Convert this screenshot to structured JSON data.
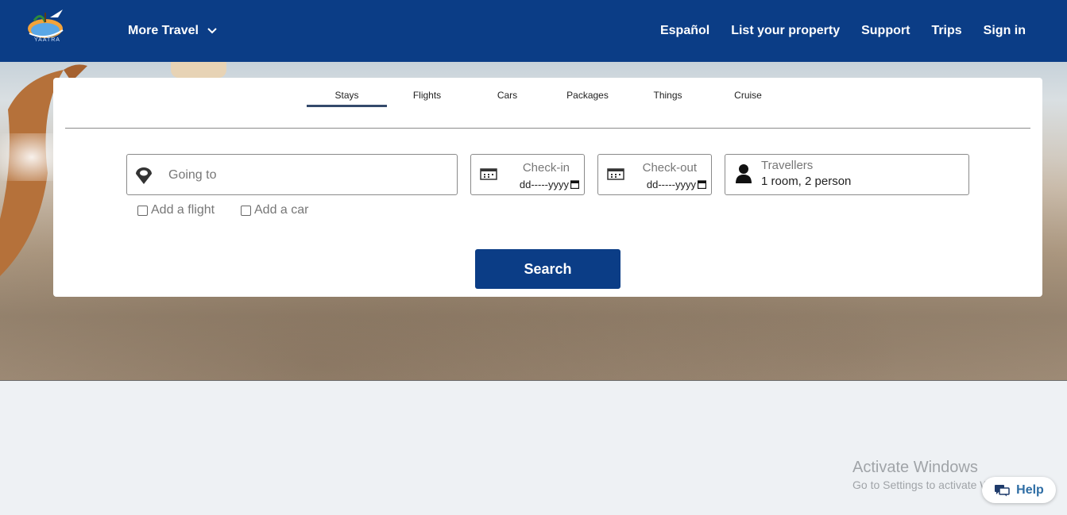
{
  "header": {
    "logo_text": "YAATRA",
    "more_travel": "More Travel",
    "nav": [
      "Español",
      "List your property",
      "Support",
      "Trips",
      "Sign in"
    ]
  },
  "tabs": [
    {
      "label": "Stays",
      "active": true
    },
    {
      "label": "Flights"
    },
    {
      "label": "Cars"
    },
    {
      "label": "Packages"
    },
    {
      "label": "Things"
    },
    {
      "label": "Cruise"
    }
  ],
  "search": {
    "going_placeholder": "Going to",
    "checkin_label": "Check-in",
    "checkin_value": "dd-----yyyy",
    "checkout_label": "Check-out",
    "checkout_value": "dd-----yyyy",
    "travellers_label": "Travellers",
    "travellers_value": "1 room, 2 person",
    "add_flight": "Add a flight",
    "add_car": "Add a car",
    "button": "Search"
  },
  "watermark": {
    "title": "Activate Windows",
    "subtitle": "Go to Settings to activate Windows."
  },
  "help": {
    "label": "Help"
  },
  "colors": {
    "primary": "#0b3d86",
    "tab_underline": "#344a6b",
    "page_bg": "#eef1f4"
  }
}
